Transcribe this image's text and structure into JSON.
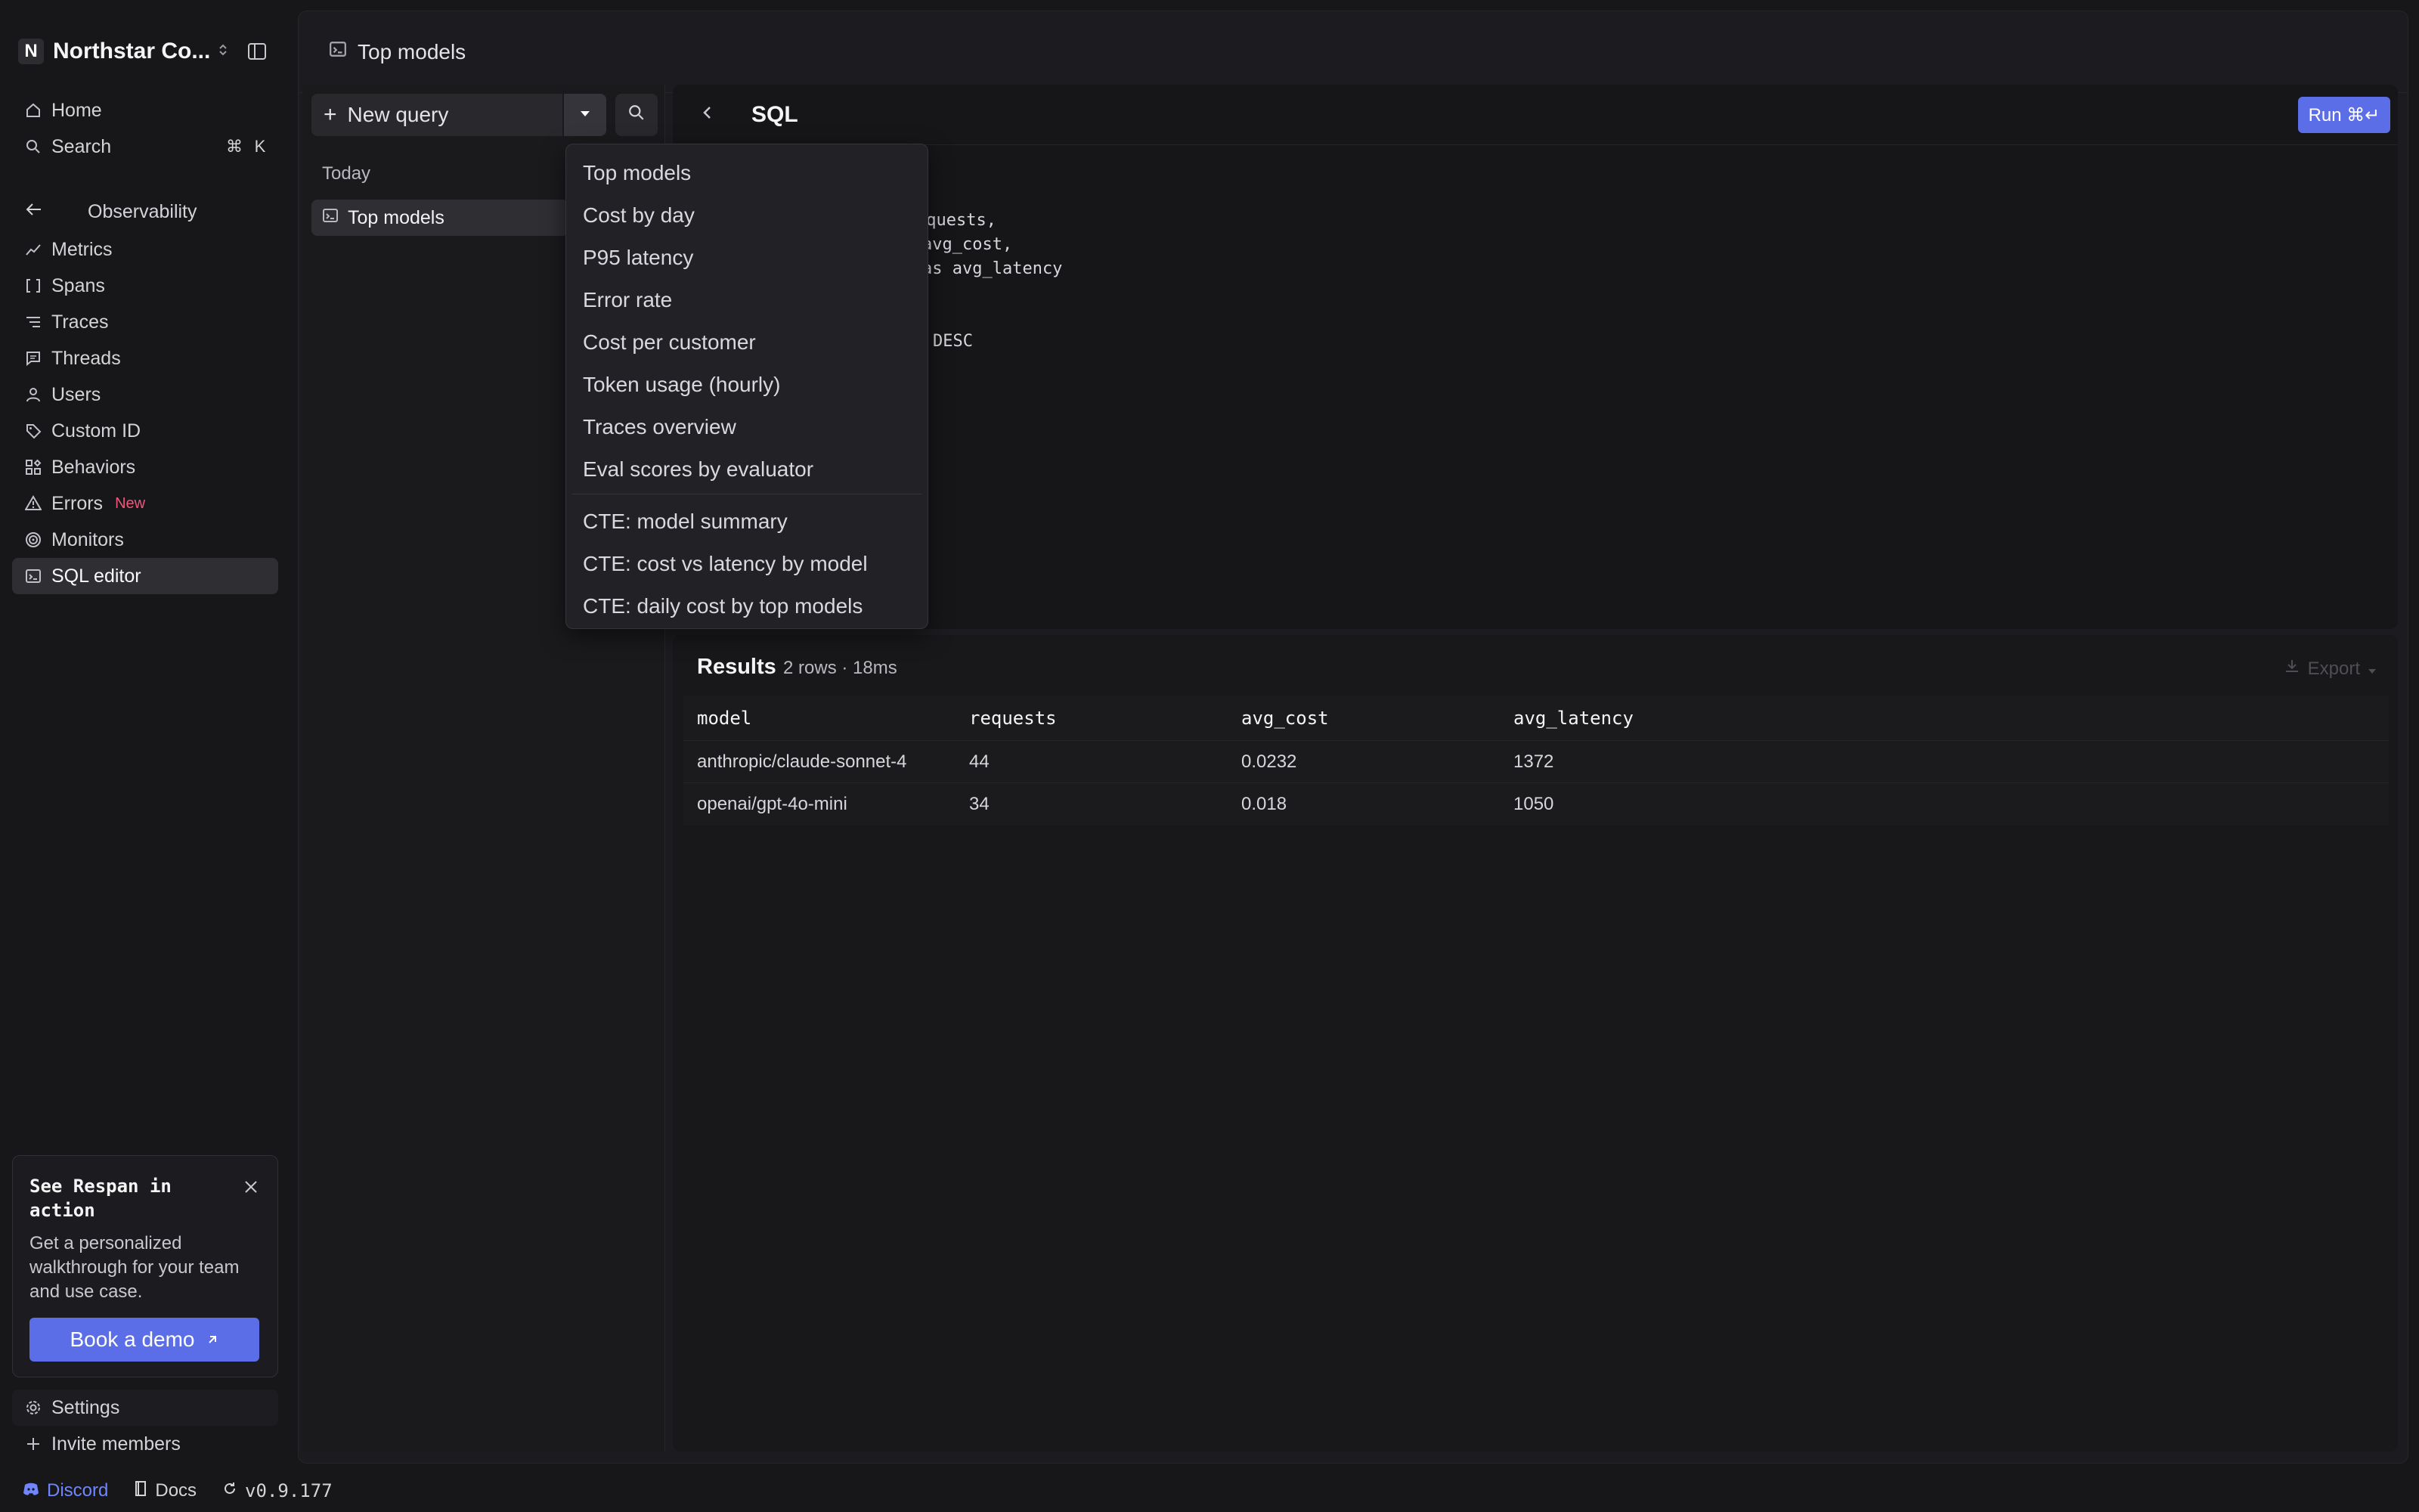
{
  "sidebar": {
    "org_initial": "N",
    "org_name": "Northstar Co...",
    "top_items": [
      {
        "label": "Home"
      },
      {
        "label": "Search",
        "shortcut": [
          "⌘",
          "K"
        ]
      }
    ],
    "section_label": "Observability",
    "items": [
      {
        "label": "Metrics"
      },
      {
        "label": "Spans"
      },
      {
        "label": "Traces"
      },
      {
        "label": "Threads"
      },
      {
        "label": "Users"
      },
      {
        "label": "Custom ID"
      },
      {
        "label": "Behaviors"
      },
      {
        "label": "Errors",
        "badge": "New"
      },
      {
        "label": "Monitors"
      },
      {
        "label": "SQL editor"
      }
    ],
    "demo_card": {
      "title": "See Respan in action",
      "body": "Get a personalized walkthrough for your team and use case.",
      "button": "Book a demo"
    },
    "bottom_items": [
      {
        "label": "Settings"
      },
      {
        "label": "Invite members"
      }
    ]
  },
  "footer": {
    "discord": "Discord",
    "docs": "Docs",
    "version": "v0.9.177"
  },
  "header": {
    "title": "Top models"
  },
  "query_panel": {
    "new_query": "New query",
    "group_label": "Today",
    "queries": [
      {
        "label": "Top models"
      }
    ]
  },
  "editor": {
    "title": "SQL",
    "run_label": "Run ⌘↵",
    "visible_code_lines": [
      "equests,",
      "avg_cost,",
      "as avg_latency",
      "DESC"
    ]
  },
  "menu": {
    "items": [
      "Top models",
      "Cost by day",
      "P95 latency",
      "Error rate",
      "Cost per customer",
      "Token usage (hourly)",
      "Traces overview",
      "Eval scores by evaluator"
    ],
    "cte_items": [
      "CTE: model summary",
      "CTE: cost vs latency by model",
      "CTE: daily cost by top models"
    ]
  },
  "results": {
    "title": "Results",
    "meta": "2 rows · 18ms",
    "export_label": "Export",
    "columns": [
      "model",
      "requests",
      "avg_cost",
      "avg_latency"
    ],
    "rows": [
      [
        "anthropic/claude-sonnet-4",
        "44",
        "0.0232",
        "1372"
      ],
      [
        "openai/gpt-4o-mini",
        "34",
        "0.018",
        "1050"
      ]
    ]
  },
  "colors": {
    "accent": "#5b6ee8",
    "new_badge": "#f0577a",
    "discord": "#6f86ff",
    "background": "#17171a"
  }
}
